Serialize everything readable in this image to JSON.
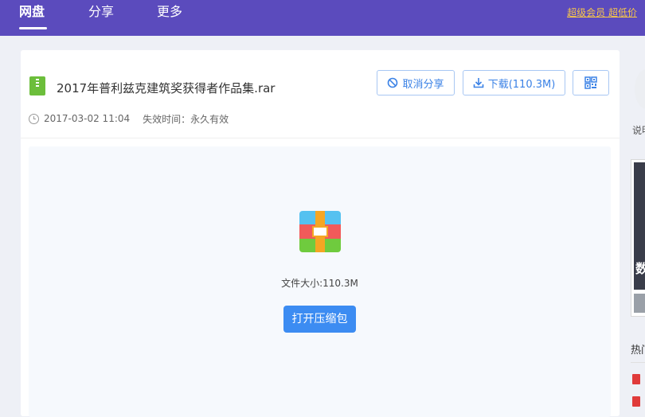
{
  "nav": {
    "items": [
      "网盘",
      "分享",
      "更多"
    ],
    "vip_link": "超级会员 超低价"
  },
  "file": {
    "name": "2017年普利兹克建筑奖获得者作品集.rar",
    "date": "2017-03-02 11:04",
    "expire": "失效时间：永久有效"
  },
  "actions": {
    "cancel_share": "取消分享",
    "download": "下载(110.3M)"
  },
  "preview": {
    "size_text": "文件大小:110.3M",
    "open_button": "打开压缩包"
  },
  "sidebar": {
    "label": "说明",
    "hot_title": "热门",
    "ad_text": "数"
  },
  "colors": {
    "topbar": "#5b4bbd",
    "accent": "#3c8cf2",
    "vip": "#f7c64a"
  }
}
